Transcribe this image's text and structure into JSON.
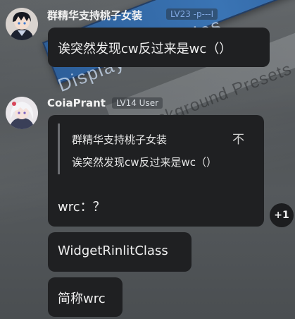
{
  "background": {
    "strip_text": "Display Properties",
    "strip2_text": "Background Presets"
  },
  "messages": [
    {
      "user": {
        "name": "群精华支持桃子女装",
        "level": "LV23 -p---I",
        "avatar": "avatar-dark-hair-boy"
      },
      "text": "诶突然发现cw反过来是wc（）"
    },
    {
      "user": {
        "name": "CoiaPrant",
        "level": "LV14 User",
        "avatar": "avatar-white-hair-girl"
      },
      "quote": {
        "author": "群精华支持桃子女装",
        "text": "诶突然发现cw反过来是wc（）",
        "jump_icon": "不"
      },
      "text": "wrc：？",
      "reaction": {
        "label": "+1"
      }
    },
    {
      "text": "WidgetRinlitClass"
    },
    {
      "text": "简称wrc"
    }
  ],
  "colors": {
    "bubble": "#1f2022",
    "accent_strip": "#3a74b4"
  }
}
